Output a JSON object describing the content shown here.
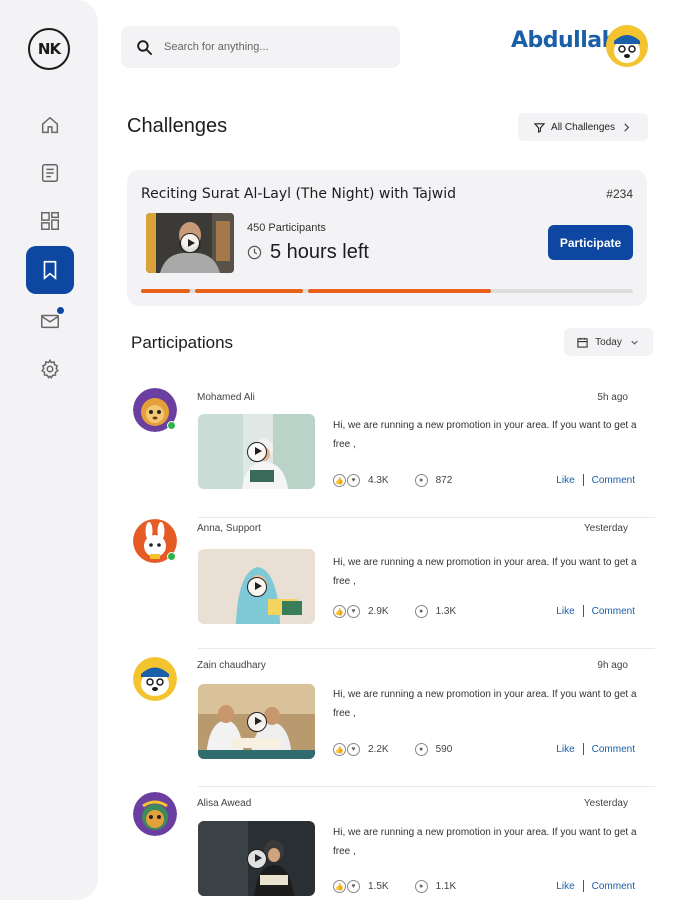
{
  "brand": {
    "logo_text": "NK"
  },
  "sidebar": {
    "items": [
      {
        "icon": "home-icon"
      },
      {
        "icon": "document-icon"
      },
      {
        "icon": "dashboard-icon"
      },
      {
        "icon": "bookmark-icon",
        "active": true
      },
      {
        "icon": "mail-icon",
        "badge": true
      },
      {
        "icon": "gear-icon"
      }
    ]
  },
  "search": {
    "placeholder": "Search for anything..."
  },
  "user": {
    "name": "Abdullah"
  },
  "challenges": {
    "title": "Challenges",
    "filter_label": "All Challenges",
    "card": {
      "title": "Reciting Surat Al-Layl (The Night) with Tajwid",
      "id": "#234",
      "participants": "450 Participants",
      "time_left": "5 hours left",
      "button": "Participate",
      "progress_fraction": 0.71
    }
  },
  "participations": {
    "title": "Participations",
    "filter_label": "Today",
    "posts": [
      {
        "name": "Mohamed Ali",
        "time": "5h ago",
        "text": "Hi, we are running a new promotion in your area. If you want to get a free ,",
        "likes": "4.3K",
        "views": "872",
        "like": "Like",
        "comment": "Comment",
        "online": true
      },
      {
        "name": "Anna, Support",
        "time": "Yesterday",
        "text": "Hi, we are running a new promotion in your area. If you want to get a free ,",
        "likes": "2.9K",
        "views": "1.3K",
        "like": "Like",
        "comment": "Comment",
        "online": true
      },
      {
        "name": "Zain chaudhary",
        "time": "9h ago",
        "text": "Hi, we are running a new promotion in your area. If you want to get a free ,",
        "likes": "2.2K",
        "views": "590",
        "like": "Like",
        "comment": "Comment",
        "online": false
      },
      {
        "name": "Alisa Awead",
        "time": "Yesterday",
        "text": "Hi, we are running a new promotion in your area. If you want to get a free ,",
        "likes": "1.5K",
        "views": "1.1K",
        "like": "Like",
        "comment": "Comment",
        "online": false
      }
    ]
  },
  "colors": {
    "primary": "#0d47a1",
    "accent": "#e8611a",
    "link": "#1a5fa8",
    "online": "#2fb24c"
  }
}
